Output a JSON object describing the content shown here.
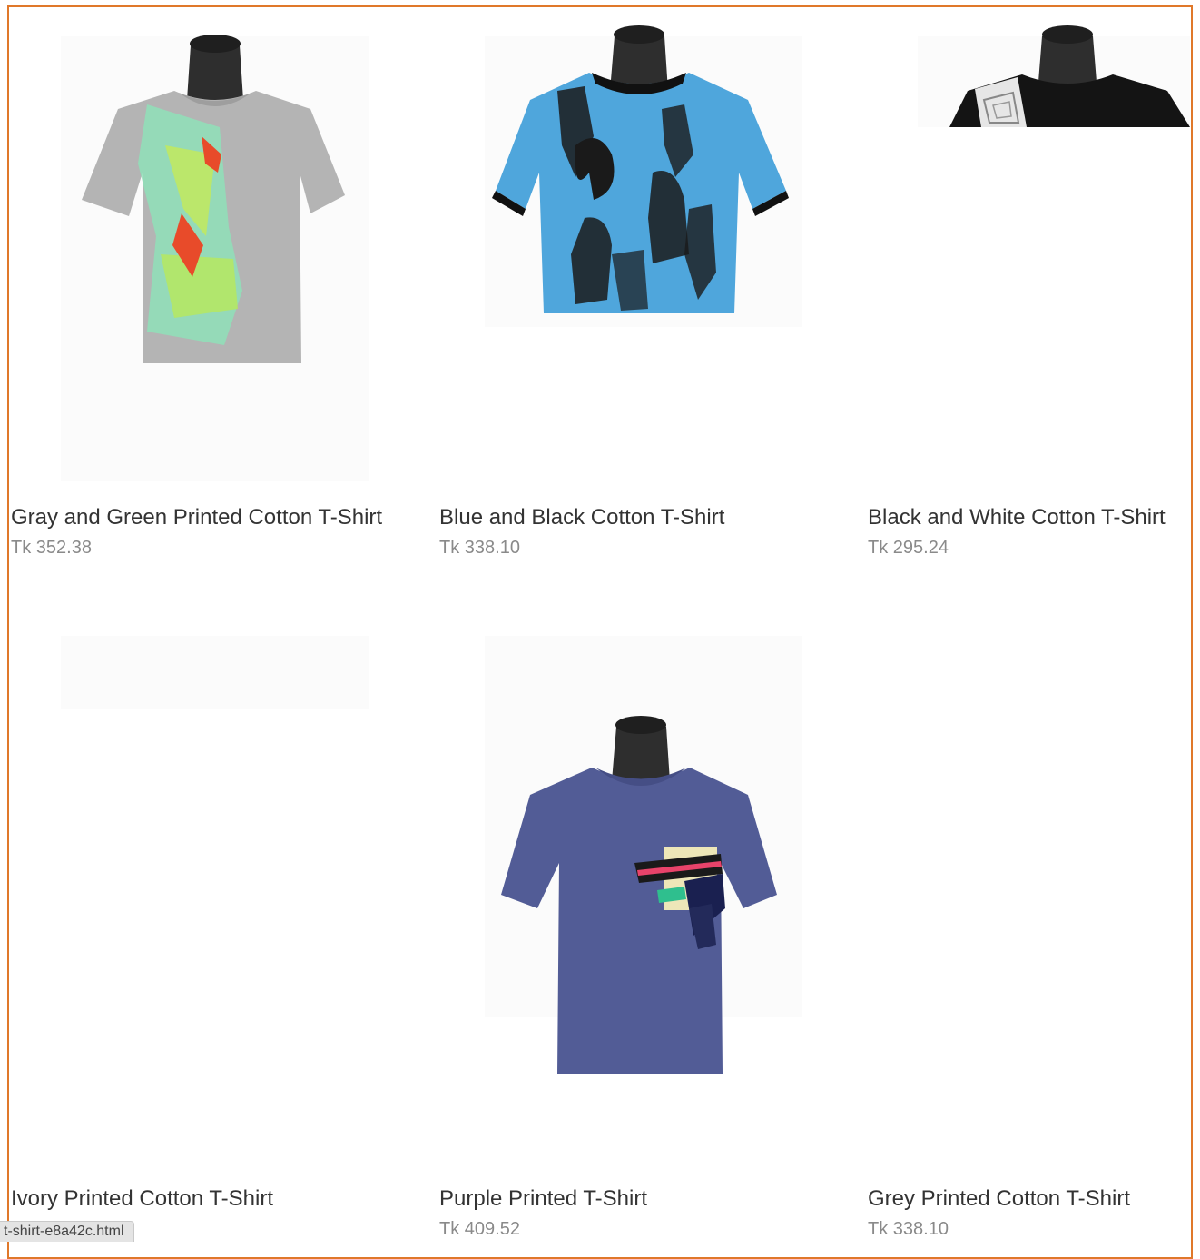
{
  "colors": {
    "frame_border": "#e0782a",
    "title_text": "#333333",
    "price_text": "#8a8a8a"
  },
  "products": [
    {
      "title": "Gray and Green Printed Cotton T-Shirt",
      "price": "Tk 352.38",
      "image": "gray-green-tshirt"
    },
    {
      "title": "Blue and Black Cotton T-Shirt",
      "price": "Tk 338.10",
      "image": "blue-black-tshirt"
    },
    {
      "title": "Black and White Cotton T-Shirt",
      "price": "Tk 295.24",
      "image": "black-white-tshirt"
    },
    {
      "title": "Ivory Printed Cotton T-Shirt",
      "price": "",
      "image": "ivory-tshirt"
    },
    {
      "title": "Purple Printed T-Shirt",
      "price": "Tk 409.52",
      "image": "purple-tshirt"
    },
    {
      "title": "Grey Printed Cotton T-Shirt",
      "price": "Tk 338.10",
      "image": "grey-tshirt"
    }
  ],
  "status_bar": {
    "url": "t-shirt-e8a42c.html"
  }
}
